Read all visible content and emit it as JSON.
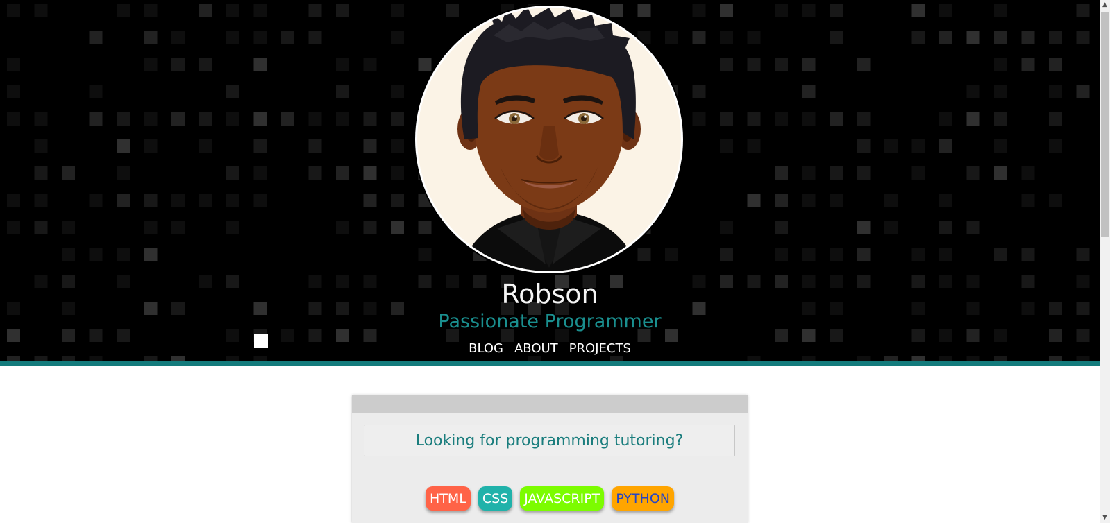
{
  "profile": {
    "name": "Robson",
    "tagline": "Passionate Programmer"
  },
  "nav": {
    "items": [
      {
        "label": "BLOG"
      },
      {
        "label": "ABOUT"
      },
      {
        "label": "PROJECTS"
      }
    ]
  },
  "card": {
    "question": "Looking for programming tutoring?",
    "tags": [
      {
        "label": "HTML",
        "bg": "#ff6347",
        "color": "#ffffff"
      },
      {
        "label": "CSS",
        "bg": "#20b2aa",
        "color": "#ffffff"
      },
      {
        "label": "JAVASCRIPT",
        "bg": "#7cfc00",
        "color": "#ffffff"
      },
      {
        "label": "PYTHON",
        "bg": "#ffa500",
        "color": "#2545c5"
      }
    ]
  },
  "colors": {
    "accent": "#137b7c",
    "tagline": "#1a8f8f",
    "header_bg": "#000000"
  },
  "icons": {
    "avatar": "cartoon-man-avatar",
    "scroll_up": "scroll-up-arrow-icon",
    "scroll_down": "scroll-down-arrow-icon"
  }
}
